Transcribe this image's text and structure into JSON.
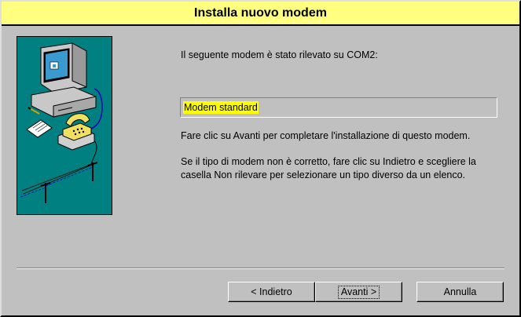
{
  "window": {
    "title": "Installa nuovo modem",
    "title_bar_color": "#ffff80",
    "background_color": "#c0c0c0"
  },
  "illustration": {
    "name": "modem-setup-illustration",
    "background_color": "#008080"
  },
  "main": {
    "detected_text": "Il seguente modem è stato rilevato su COM2:",
    "modem_name": "Modem standard",
    "modem_highlight_color": "#ffff00",
    "instruction_text": "Fare clic su Avanti per completare l'installazione di questo modem.",
    "wrong_type_text": "Se il tipo di modem non è corretto, fare clic su Indietro e scegliere la casella Non rilevare per selezionare un tipo diverso da un elenco."
  },
  "buttons": {
    "back_label": "< Indietro",
    "next_label": "Avanti >",
    "cancel_label": "Annulla"
  }
}
